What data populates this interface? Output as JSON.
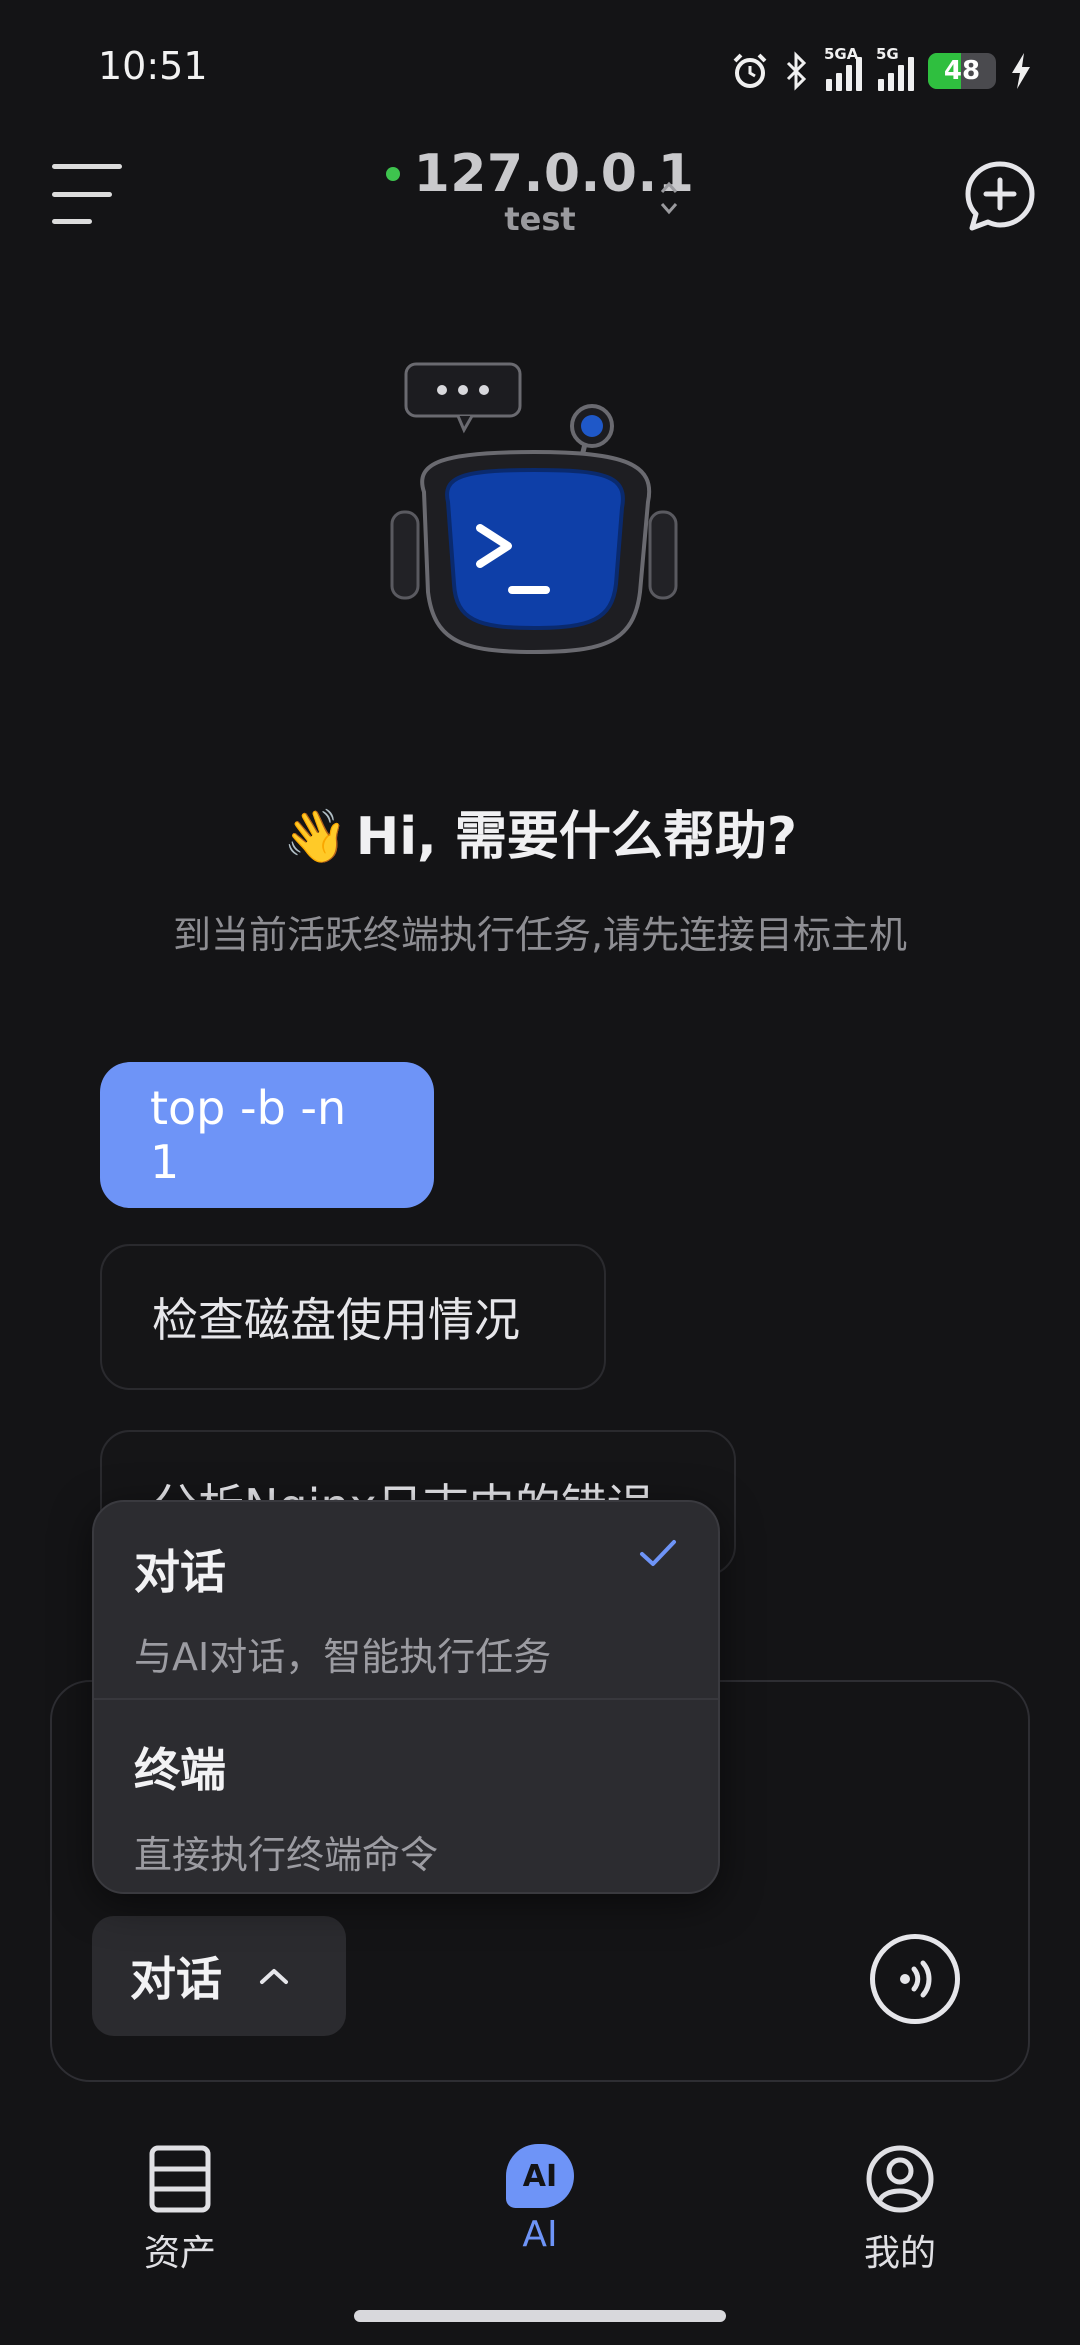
{
  "status_bar": {
    "time": "10:51",
    "signal1_label": "5GA",
    "signal2_label": "5G",
    "battery_level": "48",
    "battery_percent": 48
  },
  "header": {
    "host_ip": "127.0.0.1",
    "host_name": "test",
    "connection_status_color": "#3ec34e"
  },
  "hero": {
    "wave_emoji": "👋",
    "greeting": "Hi, 需要什么帮助?",
    "subtitle": "到当前活跃终端执行任务,请先连接目标主机"
  },
  "suggestions": [
    {
      "label": "top -b -n 1"
    },
    {
      "label": "检查磁盘使用情况"
    },
    {
      "label": "分析Nginx日志中的错误"
    }
  ],
  "mode_menu": {
    "items": [
      {
        "title": "对话",
        "description": "与AI对话，智能执行任务",
        "selected": true
      },
      {
        "title": "终端",
        "description": "直接执行终端命令",
        "selected": false
      }
    ]
  },
  "input": {
    "mode_label": "对话",
    "voice_icon": "voice-icon"
  },
  "bottom_nav": {
    "items": [
      {
        "label": "资产",
        "icon": "server-icon",
        "active": false
      },
      {
        "label": "AI",
        "icon_text": "AI",
        "active": true
      },
      {
        "label": "我的",
        "icon": "user-icon",
        "active": false
      }
    ]
  },
  "colors": {
    "accent": "#6e94f7",
    "background": "#141416"
  }
}
